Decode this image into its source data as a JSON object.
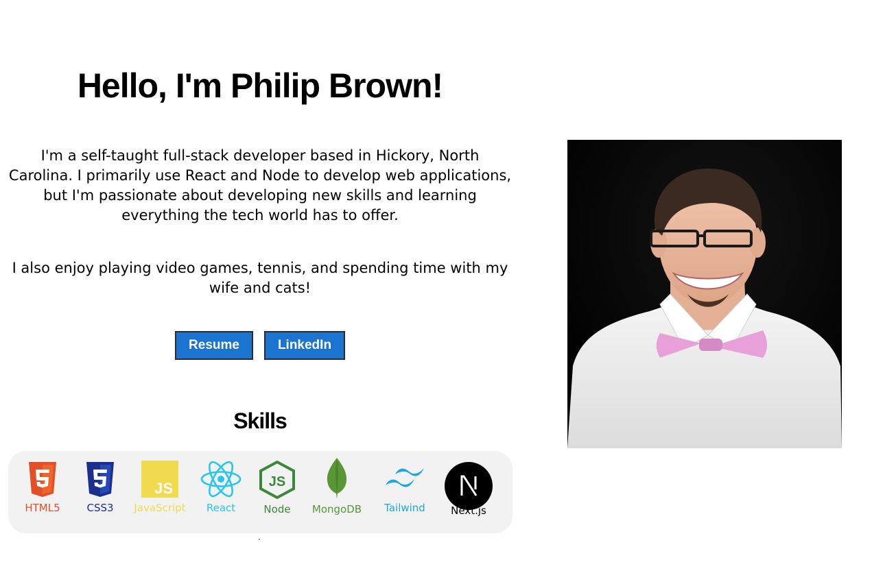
{
  "hero": {
    "title": "Hello, I'm Philip Brown!",
    "bio_1": "I'm a self-taught full-stack developer based in Hickory, North Carolina. I primarily use React and Node to develop web applications, but I'm passionate about developing new skills and learning everything the tech world has to offer.",
    "bio_2": "I also enjoy playing video games, tennis, and spending time with my wife and cats!"
  },
  "buttons": {
    "resume": "Resume",
    "linkedin": "LinkedIn",
    "color": "#1b74d0"
  },
  "skills": {
    "title": "Skills",
    "items": [
      {
        "label": "HTML5",
        "icon": "html5-icon",
        "color": "#e34f26"
      },
      {
        "label": "CSS3",
        "icon": "css3-icon",
        "color": "#1b2f8f"
      },
      {
        "label": "JavaScript",
        "icon": "javascript-icon",
        "color": "#f0db4f"
      },
      {
        "label": "React",
        "icon": "react-icon",
        "color": "#26c6f0"
      },
      {
        "label": "Node",
        "icon": "nodejs-icon",
        "color": "#3c873a"
      },
      {
        "label": "MongoDB",
        "icon": "mongodb-icon",
        "color": "#589636"
      },
      {
        "label": "Tailwind",
        "icon": "tailwind-icon",
        "color": "#1ea7e0"
      },
      {
        "label": "Next.js",
        "icon": "nextjs-icon",
        "color": "#000000"
      }
    ]
  },
  "photo": {
    "icon": "profile-photo"
  }
}
